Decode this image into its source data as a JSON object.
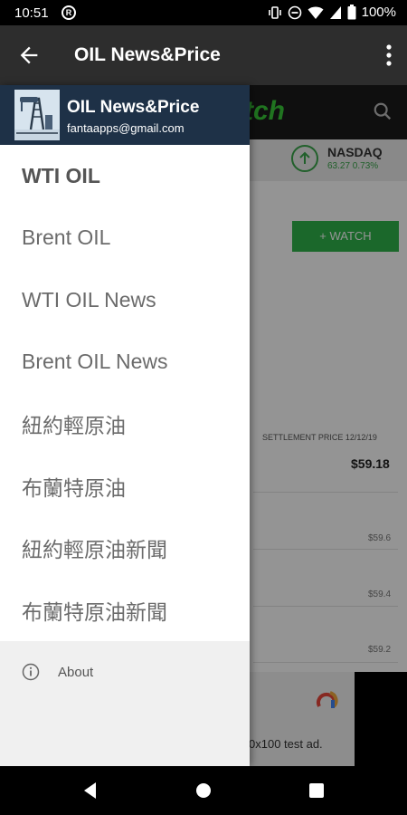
{
  "status_bar": {
    "time": "10:51",
    "battery": "100%"
  },
  "app_bar": {
    "title": "OIL News&Price"
  },
  "drawer": {
    "header": {
      "app_name": "OIL News&Price",
      "email": "fantaapps@gmail.com"
    },
    "items": [
      {
        "label": "WTI OIL",
        "active": true
      },
      {
        "label": "Brent OIL"
      },
      {
        "label": "WTI OIL News"
      },
      {
        "label": "Brent OIL News"
      },
      {
        "label": "紐約輕原油"
      },
      {
        "label": "布蘭特原油"
      },
      {
        "label": "紐約輕原油新聞"
      },
      {
        "label": "布蘭特原油新聞"
      }
    ],
    "footer": {
      "about_label": "About"
    }
  },
  "background": {
    "brand_partial": "tch",
    "ticker": {
      "name": "NASDAQ",
      "value": "63.27 0.73%"
    },
    "watch_label": "+ WATCH",
    "settlement_label": "SETTLEMENT PRICE 12/12/19",
    "price": "$59.18",
    "y_ticks": [
      "$59.6",
      "$59.4",
      "$59.2"
    ],
    "ad_text": "0x100 test ad."
  },
  "colors": {
    "header_bg": "#1e3147",
    "appbar_bg": "#2d2d2d",
    "accent_green": "#2fb34a"
  }
}
